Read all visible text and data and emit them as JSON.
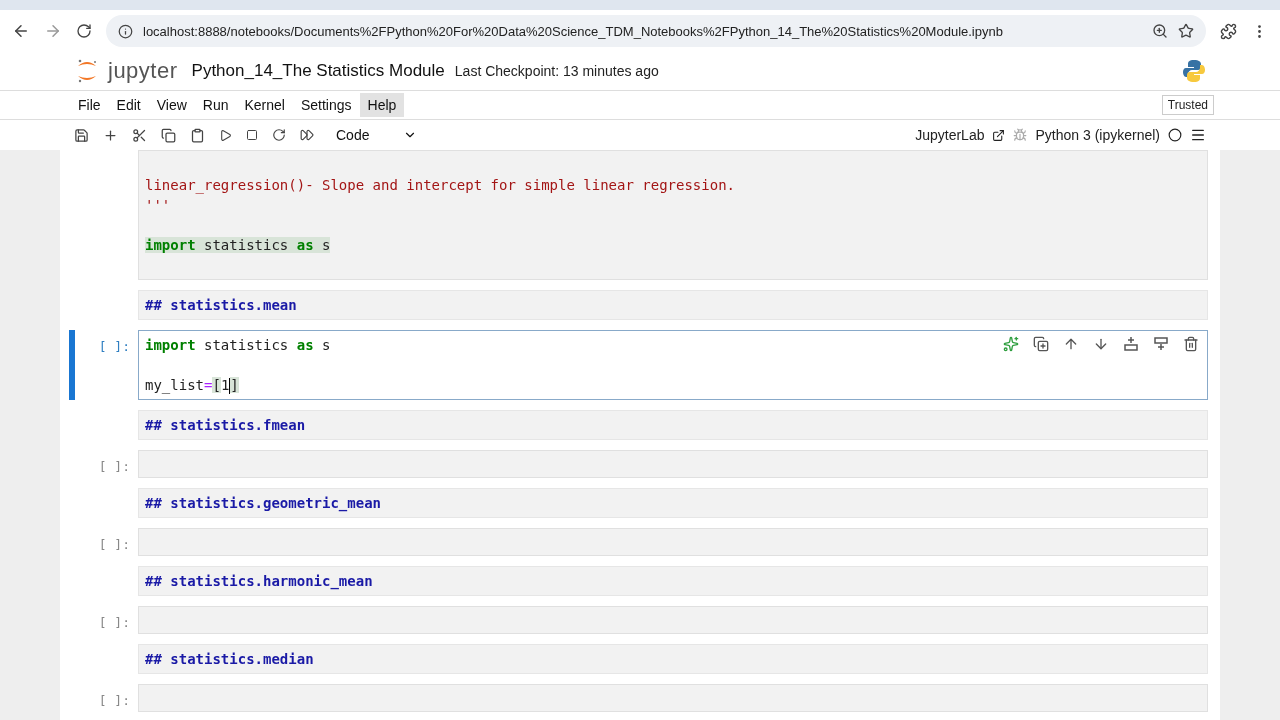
{
  "browser": {
    "url": "localhost:8888/notebooks/Documents%2FPython%20For%20Data%20Science_TDM_Notebooks%2FPython_14_The%20Statistics%20Module.ipynb"
  },
  "header": {
    "logo_text": "jupyter",
    "title": "Python_14_The Statistics Module",
    "checkpoint": "Last Checkpoint: 13 minutes ago"
  },
  "menu": [
    {
      "label": "File",
      "selected": false
    },
    {
      "label": "Edit",
      "selected": false
    },
    {
      "label": "View",
      "selected": false
    },
    {
      "label": "Run",
      "selected": false
    },
    {
      "label": "Kernel",
      "selected": false
    },
    {
      "label": "Settings",
      "selected": false
    },
    {
      "label": "Help",
      "selected": true
    }
  ],
  "trusted": "Trusted",
  "toolbar": {
    "cell_type": "Code",
    "jupyterlab": "JupyterLab",
    "kernel": "Python 3 (ipykernel)"
  },
  "cells": [
    {
      "kind": "code",
      "selected": false,
      "lines": [
        {
          "kind": "blank"
        },
        {
          "kind": "code",
          "tokens": [
            {
              "t": "linear_regression()- Slope and intercept for simple linear regression.",
              "kind": "str"
            }
          ]
        },
        {
          "kind": "code",
          "tokens": [
            {
              "t": "'''",
              "kind": "str"
            }
          ]
        },
        {
          "kind": "blank"
        },
        {
          "kind": "code",
          "tokens": [
            {
              "t": "import",
              "kind": "kw",
              "highlight": true
            },
            {
              "t": " statistics ",
              "kind": "plain",
              "highlight": true
            },
            {
              "t": "as",
              "kind": "kw",
              "highlight": true
            },
            {
              "t": " s",
              "kind": "plain",
              "highlight": true
            }
          ]
        },
        {
          "kind": "blank"
        }
      ]
    },
    {
      "kind": "markdown",
      "text": "## statistics.mean"
    },
    {
      "kind": "code",
      "prompt": "[ ]:",
      "selected": true,
      "lines": [
        {
          "kind": "code",
          "tokens": [
            {
              "t": "import",
              "kind": "kw"
            },
            {
              "t": " statistics ",
              "kind": "plain"
            },
            {
              "t": "as",
              "kind": "kw"
            },
            {
              "t": " s",
              "kind": "plain"
            }
          ]
        },
        {
          "kind": "blank"
        },
        {
          "kind": "code",
          "tokens": [
            {
              "t": "my_list",
              "kind": "plain"
            },
            {
              "t": "=",
              "kind": "op"
            },
            {
              "t": "[",
              "kind": "plain",
              "highlight": true
            },
            {
              "t": "1",
              "kind": "plain",
              "cursor": true
            },
            {
              "t": "]",
              "kind": "plain",
              "highlight": true
            }
          ]
        }
      ]
    },
    {
      "kind": "markdown",
      "text": "## statistics.fmean"
    },
    {
      "kind": "code",
      "prompt": "[ ]:",
      "selected": false
    },
    {
      "kind": "markdown",
      "text": "## statistics.geometric_mean"
    },
    {
      "kind": "code",
      "prompt": "[ ]:",
      "selected": false
    },
    {
      "kind": "markdown",
      "text": "## statistics.harmonic_mean"
    },
    {
      "kind": "code",
      "prompt": "[ ]:",
      "selected": false
    },
    {
      "kind": "markdown",
      "text": "## statistics.median"
    },
    {
      "kind": "code",
      "prompt": "[ ]:",
      "selected": false
    }
  ]
}
